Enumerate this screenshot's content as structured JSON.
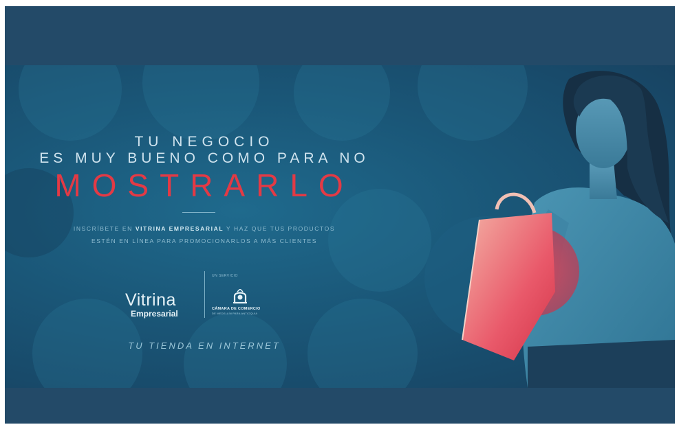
{
  "banner": {
    "headline_line1": "TU NEGOCIO",
    "headline_line2": "ES MUY BUENO COMO PARA NO",
    "headline_big": "MOSTRARLO",
    "desc_line1_pre": "INSCRÍBETE EN ",
    "desc_line1_bold": "VITRINA EMPRESARIAL",
    "desc_line1_post": " Y HAZ QUE TUS PRODUCTOS",
    "desc_line2": "ESTÉN EN LÍNEA PARA PROMOCIONARLOS A MÁS CLIENTES",
    "logo_word1": "Vitrina",
    "logo_word2": "Empresarial",
    "service_label": "UN SERVICIO",
    "chamber_name": "CÁMARA DE COMERCIO",
    "chamber_sub": "DE MEDELLÍN PARA ANTIOQUIA",
    "tagline": "TU TIENDA EN INTERNET"
  },
  "colors": {
    "background": "#234a68",
    "accent_red": "#e33a45",
    "text_light": "#cfe3ee"
  }
}
